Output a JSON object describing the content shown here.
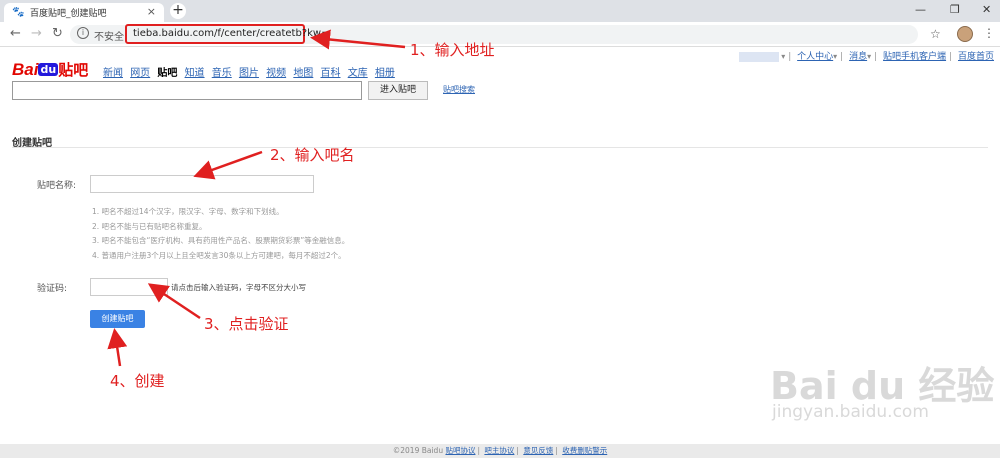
{
  "browser": {
    "tab_title": "百度贴吧_创建贴吧",
    "tab_close": "×",
    "new_tab": "+",
    "insecure_label": "不安全",
    "url": "tieba.baidu.com/f/center/createtb?kw=",
    "window_controls": [
      "—",
      "❐",
      "✕"
    ]
  },
  "header": {
    "logo_left": "Bai",
    "logo_du": "du",
    "logo_right": "贴吧",
    "nav": [
      "新闻",
      "网页",
      "贴吧",
      "知道",
      "音乐",
      "图片",
      "视频",
      "地图",
      "百科",
      "文库",
      "相册"
    ],
    "active_nav": "贴吧",
    "user_links": {
      "center": "个人中心",
      "messages": "消息",
      "mobile_client": "贴吧手机客户端",
      "homepage": "百度首页"
    },
    "search_button": "进入贴吧",
    "search_link": "贴吧搜索"
  },
  "form": {
    "section_title": "创建贴吧",
    "name_label": "贴吧名称:",
    "rules": [
      "1. 吧名不超过14个汉字，限汉字、字母、数字和下划线。",
      "2. 吧名不能与已有贴吧名称重复。",
      "3. 吧名不能包含“医疗机构、具有药用性产品名、股票期货彩票”等金融信息。",
      "4. 普通用户注册3个月以上且全吧发言30条以上方可建吧，每月不超过2个。"
    ],
    "captcha_label": "验证码:",
    "captcha_hint": "请点击后输入验证码，字母不区分大小写",
    "create_button": "创建贴吧"
  },
  "annotations": {
    "step1": "1、输入地址",
    "step2": "2、输入吧名",
    "step3": "3、点击验证",
    "step4": "4、创建"
  },
  "watermark": {
    "big": "Bai du 经验",
    "small": "jingyan.baidu.com"
  },
  "footer": {
    "copyright": "©2019 Baidu",
    "links": [
      "贴吧协议",
      "吧主协议",
      "意见反馈",
      "收费删贴警示"
    ]
  },
  "colors": {
    "annotation_red": "#e02020",
    "link_blue": "#2d64b3",
    "button_blue": "#3a82e4"
  }
}
